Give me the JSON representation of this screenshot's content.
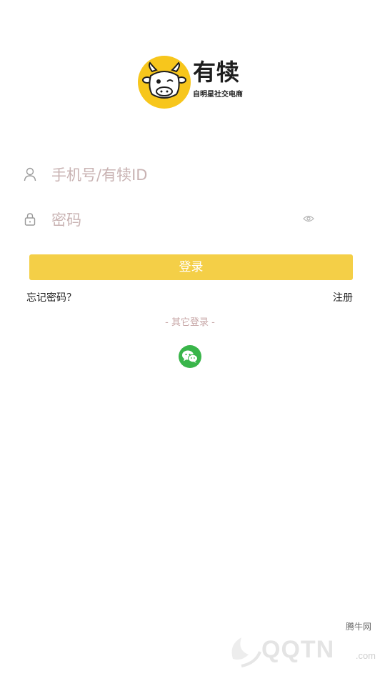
{
  "brand": {
    "name": "有犊",
    "slogan": "自明星社交电商",
    "logo_icon": "cow-face-icon",
    "accent_color": "#f4cf47"
  },
  "login_form": {
    "username": {
      "placeholder": "手机号/有犊ID",
      "value": "",
      "icon": "user-icon"
    },
    "password": {
      "placeholder": "密码",
      "value": "",
      "icon": "lock-icon",
      "toggle_icon": "eye-icon"
    },
    "login_label": "登录",
    "forgot_label": "忘记密码？",
    "register_label": "注册"
  },
  "other_login": {
    "label": "- 其它登录 -",
    "wechat_icon": "wechat-icon",
    "wechat_color": "#39b54a"
  },
  "watermark": {
    "label": "腾牛网",
    "text": "QQTN",
    "suffix": ".com"
  }
}
